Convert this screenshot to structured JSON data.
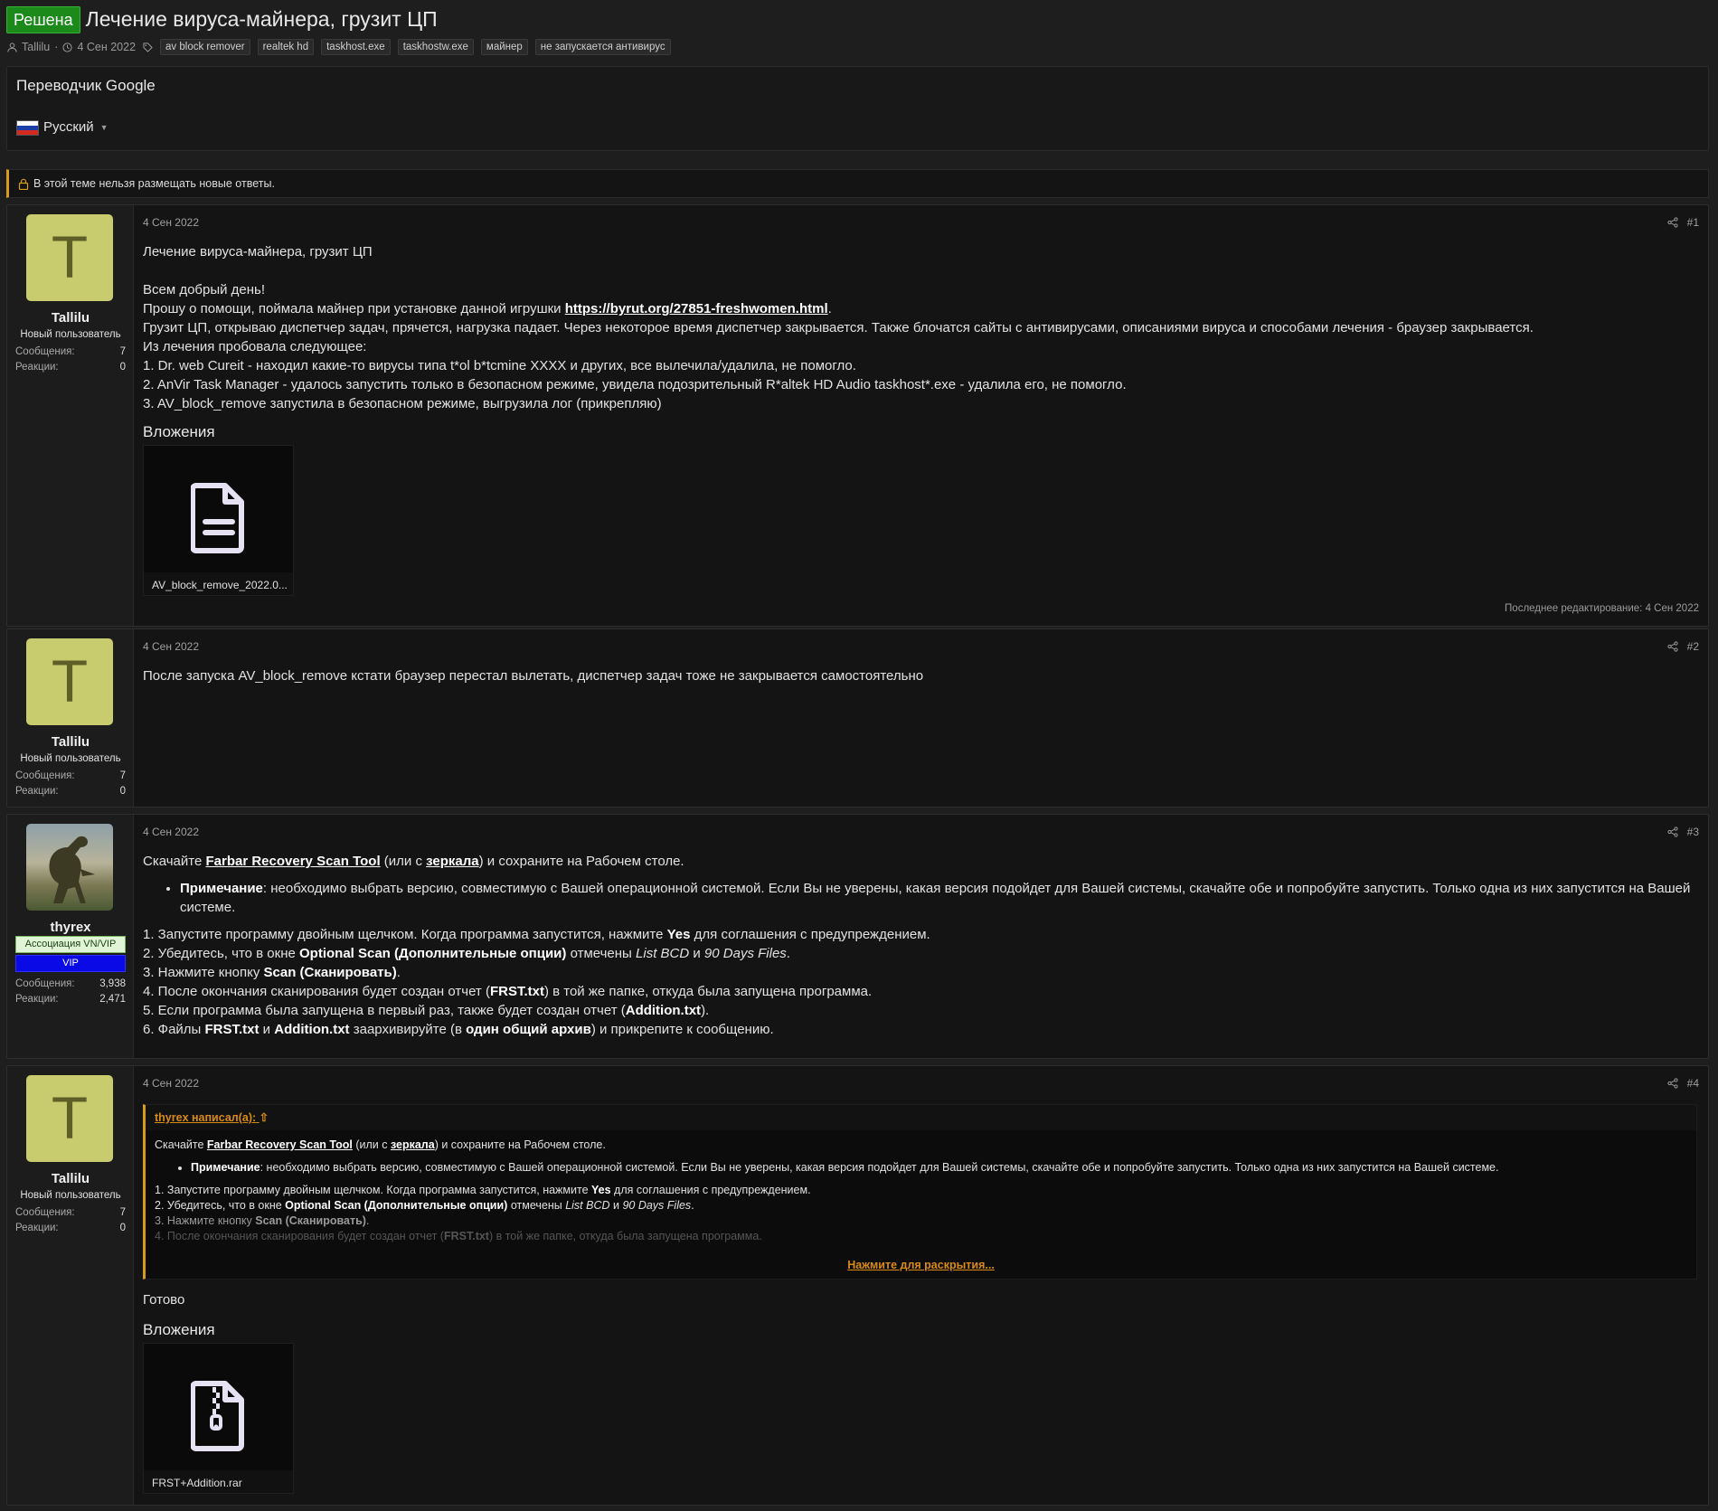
{
  "thread": {
    "status_badge": "Решена",
    "title": "Лечение вируса-майнера, грузит ЦП",
    "author": "Tallilu",
    "date": "4 Сен 2022",
    "tags": [
      "av block remover",
      "realtek hd",
      "taskhost.exe",
      "taskhostw.exe",
      "майнер",
      "не запускается антивирус"
    ]
  },
  "translator": {
    "title": "Переводчик Google",
    "language": "Русский"
  },
  "notice": "В этой теме нельзя размещать новые ответы.",
  "labels": {
    "messages": "Сообщения:",
    "reactions": "Реакции:",
    "attachments": "Вложения",
    "last_edit": "Последнее редактирование: 4 Сен 2022",
    "quote_author": "thyrex написал(а):",
    "expand": "Нажмите для раскрытия..."
  },
  "posts": [
    {
      "number": "#1",
      "date": "4 Сен 2022",
      "user": {
        "name": "Tallilu",
        "avatar_letter": "T",
        "title": "Новый пользователь",
        "messages": "7",
        "reactions": "0"
      },
      "lines": {
        "l1": "Лечение вируса-майнера, грузит ЦП",
        "l2": "Всем добрый день!",
        "l3_pre": "Прошу о помощи, поймала майнер при установке данной игрушки ",
        "l3_link": "https://byrut.org/27851-freshwomen.html",
        "l3_post": ".",
        "l4": "Грузит ЦП, открываю диспетчер задач, прячется, нагрузка падает. Через некоторое время диспетчер закрывается. Также блочатся сайты с антивирусами, описаниями вируса и способами лечения - браузер закрывается.",
        "l5": "Из лечения пробовала следующее:",
        "l6": "1. Dr. web Cureit - находил какие-то вирусы типа t*ol b*tcmine XXXX и других, все вылечила/удалила, не помогло.",
        "l7": "2. AnVir Task Manager - удалось запустить только в безопасном режиме, увидела подозрительный R*altek HD Audio taskhost*.exe - удалила его, не помогло.",
        "l8": "3. AV_block_remove запустила в безопасном режиме, выгрузила лог (прикрепляю)"
      },
      "attachment": {
        "name": "AV_block_remove_2022.0...",
        "icon": "file-text-icon"
      }
    },
    {
      "number": "#2",
      "date": "4 Сен 2022",
      "user": {
        "name": "Tallilu",
        "avatar_letter": "T",
        "title": "Новый пользователь",
        "messages": "7",
        "reactions": "0"
      },
      "text": "После запуска AV_block_remove кстати браузер перестал вылетать, диспетчер задач тоже не закрывается самостоятельно"
    },
    {
      "number": "#3",
      "date": "4 Сен 2022",
      "user": {
        "name": "thyrex",
        "banner1": "Ассоциация VN/VIP",
        "banner2": "VIP",
        "messages": "3,938",
        "reactions": "2,471",
        "banner1_color": "#dff5d6",
        "banner2_color": "#0a0ae6"
      },
      "t": {
        "intro_pre": "Скачайте ",
        "link1": "Farbar Recovery Scan Tool",
        "intro_mid": " (или с ",
        "link2": "зеркала",
        "intro_post": ") и сохраните на Рабочем столе.",
        "note_label": "Примечание",
        "note_text": ": необходимо выбрать версию, совместимую с Вашей операционной системой. Если Вы не уверены, какая версия подойдет для Вашей системы, скачайте обе и попробуйте запустить. Только одна из них запустится на Вашей системе.",
        "s1_pre": "1. Запустите программу двойным щелчком. Когда программа запустится, нажмите ",
        "s1_b": "Yes",
        "s1_post": " для соглашения с предупреждением.",
        "s2_pre": "2. Убедитесь, что в окне ",
        "s2_b": "Optional Scan (Дополнительные опции)",
        "s2_mid": " отмечены ",
        "s2_i1": "List BCD",
        "s2_and": " и ",
        "s2_i2": "90 Days Files",
        "s2_end": ".",
        "s3_pre": "3. Нажмите кнопку ",
        "s3_b": "Scan (Сканировать)",
        "s3_end": ".",
        "s4_pre": "4. После окончания сканирования будет создан отчет (",
        "s4_b": "FRST.txt",
        "s4_post": ") в той же папке, откуда была запущена программа.",
        "s5_pre": "5. Если программа была запущена в первый раз, также будет создан отчет (",
        "s5_b": "Addition.txt",
        "s5_post": ").",
        "s6_pre": "6. Файлы ",
        "s6_b1": "FRST.txt",
        "s6_and": " и ",
        "s6_b2": "Addition.txt",
        "s6_mid": " заархивируйте (в ",
        "s6_b3": "один общий архив",
        "s6_post": ") и прикрепите к сообщению."
      }
    },
    {
      "number": "#4",
      "date": "4 Сен 2022",
      "user": {
        "name": "Tallilu",
        "avatar_letter": "T",
        "title": "Новый пользователь",
        "messages": "7",
        "reactions": "0"
      },
      "reply": "Готово",
      "attachment": {
        "name": "FRST+Addition.rar",
        "icon": "file-archive-icon"
      }
    }
  ],
  "colors": {
    "accent_orange": "#d89b1a",
    "solved_green": "#1b8a1b",
    "avatar_bg": "#c9cb6f"
  }
}
